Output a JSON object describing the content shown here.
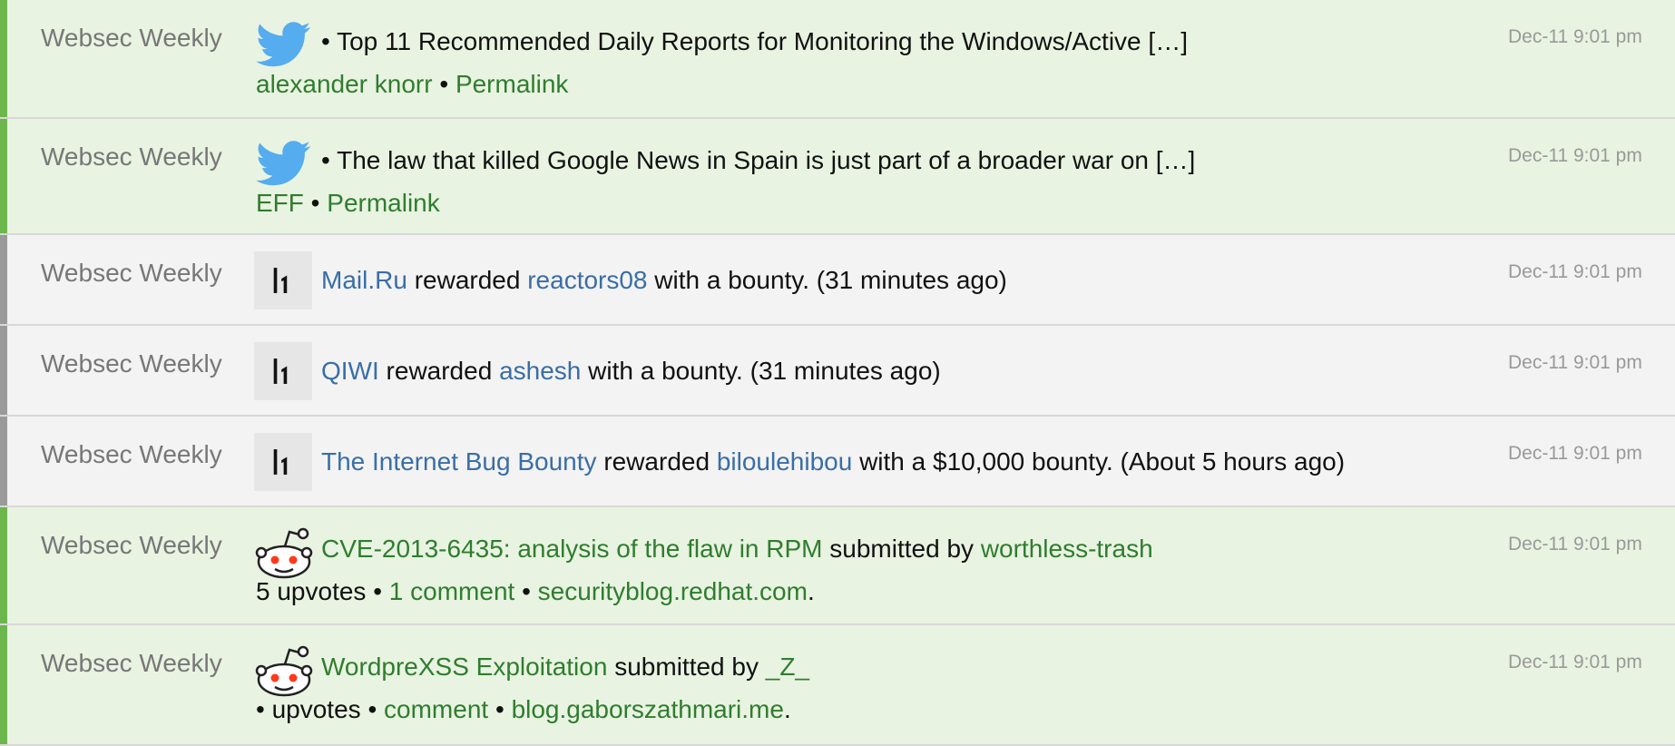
{
  "rows": [
    {
      "source": "Websec Weekly",
      "time": "Dec-11 9:01 pm",
      "bullet": "•",
      "text": "Top 11 Recommended Daily Reports for Monitoring the Windows/Active […]",
      "author": "alexander knorr",
      "sep": "•",
      "permalink": "Permalink"
    },
    {
      "source": "Websec Weekly",
      "time": "Dec-11 9:01 pm",
      "bullet": "•",
      "text": "The law that killed Google News in Spain is just part of a broader war on […]",
      "author": "EFF",
      "sep": "•",
      "permalink": "Permalink"
    },
    {
      "source": "Websec Weekly",
      "time": "Dec-11 9:01 pm",
      "org": "Mail.Ru",
      "mid": "rewarded",
      "user": "reactors08",
      "tail": "with a bounty. (31 minutes ago)"
    },
    {
      "source": "Websec Weekly",
      "time": "Dec-11 9:01 pm",
      "org": "QIWI",
      "mid": "rewarded",
      "user": "ashesh",
      "tail": "with a bounty. (31 minutes ago)"
    },
    {
      "source": "Websec Weekly",
      "time": "Dec-11 9:01 pm",
      "org": "The Internet Bug Bounty",
      "mid": "rewarded",
      "user": "biloulehibou",
      "tail": "with a $10,000 bounty. (About 5 hours ago)"
    },
    {
      "source": "Websec Weekly",
      "time": "Dec-11 9:01 pm",
      "title": "CVE-2013-6435: analysis of the flaw in RPM",
      "submitted": "submitted by",
      "user": "worthless-trash",
      "upvotes": "5 upvotes",
      "sep": "•",
      "comments": "1 comment",
      "domain": "securityblog.redhat.com",
      "period": "."
    },
    {
      "source": "Websec Weekly",
      "time": "Dec-11 9:01 pm",
      "title": "WordpreXSS Exploitation",
      "submitted": "submitted by",
      "user": "_Z_",
      "upvotes": "• upvotes",
      "sep": "•",
      "comments": "comment",
      "domain": "blog.gaborszathmari.me",
      "period": "."
    }
  ],
  "icons": {
    "twitter": "twitter-bird-icon",
    "hackerone": "hackerone-icon",
    "reddit": "reddit-alien-icon"
  },
  "colors": {
    "green_bg": "#e9f3e1",
    "gray_bg": "#f3f3f3",
    "green_bar": "#6cb64e",
    "gray_bar": "#9a9a9a",
    "green_link": "#2f7d2f",
    "blue_link": "#3a6ea5"
  }
}
